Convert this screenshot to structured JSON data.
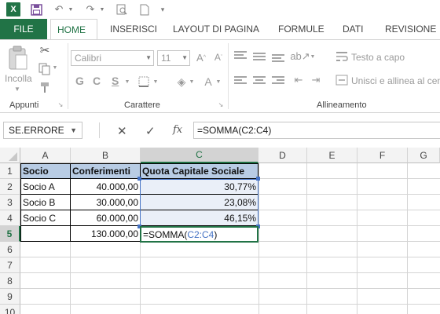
{
  "app": {
    "logo_letter": "X"
  },
  "ribbon_tabs": [
    {
      "label": "FILE"
    },
    {
      "label": "HOME"
    },
    {
      "label": "INSERISCI"
    },
    {
      "label": "LAYOUT DI PAGINA"
    },
    {
      "label": "FORMULE"
    },
    {
      "label": "DATI"
    },
    {
      "label": "REVISIONE"
    }
  ],
  "ribbon": {
    "clipboard": {
      "paste_label": "Incolla",
      "group_label": "Appunti"
    },
    "font": {
      "family": "Calibri",
      "size": "11",
      "group_label": "Carattere",
      "bold": "G",
      "italic": "C",
      "underline": "S"
    },
    "alignment": {
      "wrap_text": "Testo a capo",
      "merge_center": "Unisci e allinea al centro",
      "group_label": "Allineamento"
    }
  },
  "formula_bar": {
    "name_box": "SE.ERRORE",
    "cancel": "✕",
    "enter": "✓",
    "fx": "fx",
    "formula": "=SOMMA(C2:C4)"
  },
  "grid": {
    "columns": [
      "A",
      "B",
      "C",
      "D",
      "E",
      "F",
      "G"
    ],
    "rows": [
      "1",
      "2",
      "3",
      "4",
      "5",
      "6",
      "7",
      "8",
      "9",
      "10"
    ],
    "headers": {
      "a1": "Socio",
      "b1": "Conferimenti",
      "c1": "Quota Capitale Sociale"
    },
    "data": [
      {
        "socio": "Socio A",
        "conferimento": "40.000,00",
        "quota": "30,77%"
      },
      {
        "socio": "Socio B",
        "conferimento": "30.000,00",
        "quota": "23,08%"
      },
      {
        "socio": "Socio C",
        "conferimento": "60.000,00",
        "quota": "46,15%"
      }
    ],
    "total": {
      "conferimento": "130.000,00"
    },
    "editing": {
      "prefix": "=SOMMA(",
      "ref": "C2:C4",
      "suffix": ")"
    }
  },
  "colors": {
    "excel_green": "#217346",
    "header_fill": "#b8cce4",
    "reference_blue": "#4472c4"
  }
}
